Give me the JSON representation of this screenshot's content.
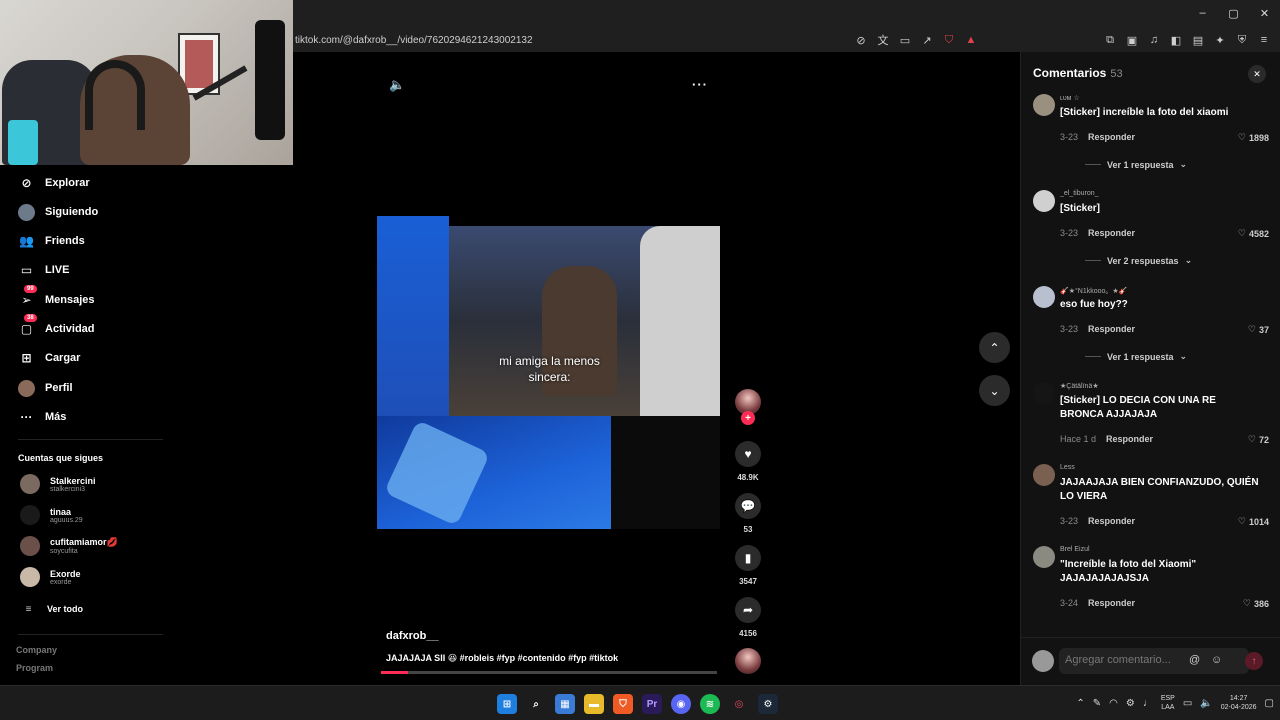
{
  "browser": {
    "url": "tiktok.com/@dafxrob__/video/7620294621243002132",
    "window_controls": [
      "–",
      "▢",
      "✕"
    ]
  },
  "sidebar": {
    "nav": [
      {
        "label": "Explorar",
        "icon": "compass-icon"
      },
      {
        "label": "Siguiendo",
        "icon": "following-avatar-icon"
      },
      {
        "label": "Friends",
        "icon": "friends-icon"
      },
      {
        "label": "LIVE",
        "icon": "live-tv-icon"
      },
      {
        "label": "Mensajes",
        "icon": "messages-icon",
        "badge": "99"
      },
      {
        "label": "Actividad",
        "icon": "activity-icon",
        "badge": "38"
      },
      {
        "label": "Cargar",
        "icon": "upload-icon"
      },
      {
        "label": "Perfil",
        "icon": "profile-avatar-icon"
      },
      {
        "label": "Más",
        "icon": "more-icon"
      }
    ],
    "following_title": "Cuentas que sigues",
    "following": [
      {
        "name": "Stalkercini",
        "handle": "stalkercini3"
      },
      {
        "name": "tinaa",
        "handle": "aguuus.29"
      },
      {
        "name": "cufitamiamor💋",
        "handle": "soycufita"
      },
      {
        "name": "Exorde",
        "handle": "exorde"
      }
    ],
    "see_all": "Ver todo",
    "footer": [
      "Company",
      "Program"
    ]
  },
  "video": {
    "caption": "mi amiga la menos sincera:",
    "author": "dafxrob__",
    "description": "JAJAJAJA SII 😆 #robleis #fyp #contenido #fyp #tiktok",
    "progress": 0.08,
    "likes": "48.9K",
    "comments": "53",
    "saves": "3547",
    "shares": "4156"
  },
  "comments_panel": {
    "title": "Comentarios",
    "count": "53",
    "input_placeholder": "Agregar comentario...",
    "reply_label": "Responder",
    "items": [
      {
        "user": "ʟᴜᴍ ☆",
        "text": "[Sticker] increíble la foto del xiaomi",
        "date": "3-23",
        "likes": "1898",
        "more": "Ver 1 respuesta"
      },
      {
        "user": "_el_tiburon_",
        "text": "[Sticker]",
        "date": "3-23",
        "likes": "4582",
        "more": "Ver 2 respuestas"
      },
      {
        "user": "🎸★°N1kkooo。★🎸",
        "text": "eso fue hoy??",
        "date": "3-23",
        "likes": "37",
        "more": "Ver 1 respuesta"
      },
      {
        "user": "★Çätälïnä★",
        "text": "[Sticker] LO DECIA CON UNA RE BRONCA AJJAJAJA",
        "date": "Hace 1 d",
        "likes": "72"
      },
      {
        "user": "Less",
        "text": "JAJAAJAJA BIEN CONFIANZUDO, QUIÉN LO VIERA",
        "date": "3-23",
        "likes": "1014"
      },
      {
        "user": "Brel Eizul",
        "text": "\"Increíble la foto del Xiaomi\" JAJAJAJAJAJSJA",
        "date": "3-24",
        "likes": "386"
      }
    ]
  },
  "taskbar": {
    "lang": "ESP",
    "layout": "LAA",
    "time": "14:27",
    "date": "02-04-2026"
  }
}
